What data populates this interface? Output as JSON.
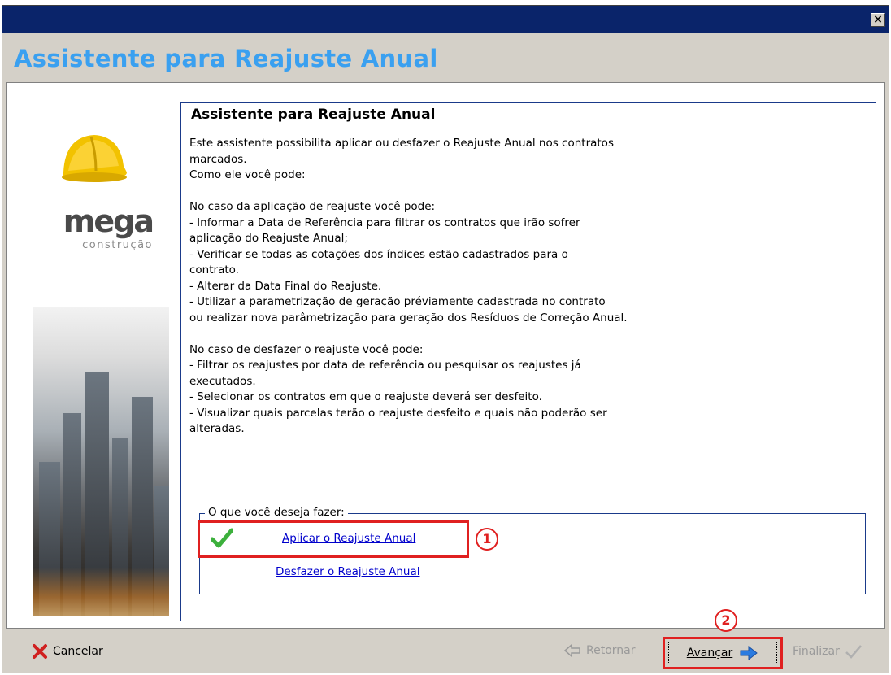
{
  "window": {
    "close_glyph": "×",
    "header_title": "Assistente para Reajuste Anual"
  },
  "sidebar": {
    "logo_main": "mega",
    "logo_sub": "construção"
  },
  "content": {
    "title": "Assistente para Reajuste Anual",
    "description": "Este assistente possibilita aplicar ou desfazer o Reajuste Anual nos contratos\nmarcados.\nComo ele você pode:\n\nNo caso da aplicação de reajuste você pode:\n- Informar a Data de Referência para filtrar os contratos que irão sofrer\naplicação do Reajuste Anual;\n- Verificar se todas as cotações dos índices estão cadastrados para o\ncontrato.\n- Alterar da Data Final do Reajuste.\n- Utilizar a parametrização de geração préviamente cadastrada no contrato\nou realizar nova parâmetrização para geração dos Resíduos de Correção Anual.\n\nNo caso de desfazer o reajuste você pode:\n- Filtrar os reajustes por data de referência ou pesquisar os reajustes já\nexecutados.\n- Selecionar os contratos em que o reajuste deverá ser desfeito.\n- Visualizar quais parcelas terão o reajuste desfeito e quais não poderão ser\nalteradas."
  },
  "options": {
    "legend": "O que você deseja fazer:",
    "apply_label": "Aplicar o Reajuste Anual",
    "undo_label": "Desfazer o Reajuste Anual",
    "selected": "apply"
  },
  "annotations": {
    "marker1": "1",
    "marker2": "2",
    "color": "#e02020"
  },
  "buttons": {
    "cancel": "Cancelar",
    "back": "Retornar",
    "next": "Avançar",
    "finish": "Finalizar"
  },
  "colors": {
    "title_bar": "#0a246a",
    "header_title": "#3aa0f0",
    "link": "#0000cc"
  }
}
